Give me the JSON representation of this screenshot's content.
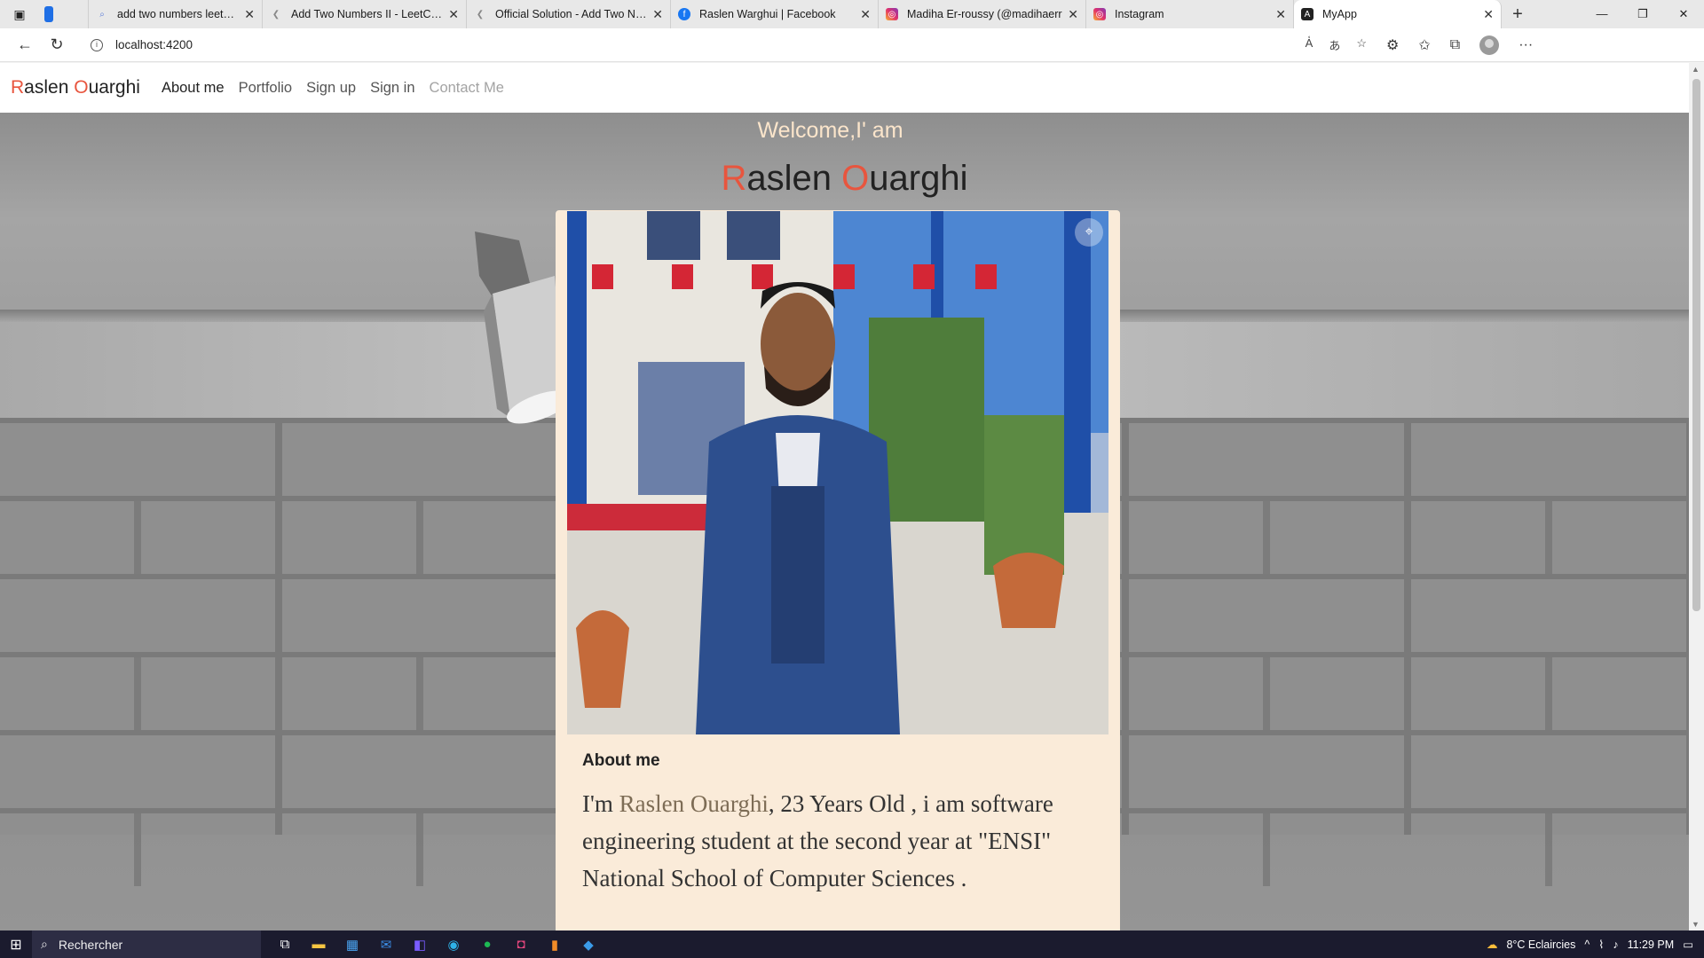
{
  "browser": {
    "tabs": [
      {
        "title": "add two numbers leetcode - Re",
        "icon": "search-icon",
        "active": false
      },
      {
        "title": "Add Two Numbers II - LeetCode",
        "icon": "leetcode-icon",
        "active": false
      },
      {
        "title": "Official Solution - Add Two Num",
        "icon": "leetcode-icon",
        "active": false
      },
      {
        "title": "Raslen Warghui | Facebook",
        "icon": "facebook-icon",
        "active": false
      },
      {
        "title": "Madiha Er-roussy (@madihaerr",
        "icon": "instagram-icon",
        "active": false
      },
      {
        "title": "Instagram",
        "icon": "instagram-icon",
        "active": false
      },
      {
        "title": "MyApp",
        "icon": "angular-icon",
        "active": true
      }
    ],
    "url": "localhost:4200"
  },
  "navbar": {
    "brand_r": "R",
    "brand_rest1": "aslen ",
    "brand_o": "O",
    "brand_rest2": "uarghi",
    "links": [
      "About me",
      "Portfolio",
      "Sign up",
      "Sign in",
      "Contact Me"
    ]
  },
  "hero": {
    "welcome": "Welcome,I' am",
    "name_r": "R",
    "name_rest1": "aslen ",
    "name_o": "O",
    "name_rest2": "uarghi"
  },
  "card": {
    "heading": "About me",
    "text_prefix": "I'm ",
    "text_name": "Raslen Ouarghi",
    "text_rest": ", 23 Years Old , i am software engineering student at the second year at \"ENSI\" National School of Computer Sciences ."
  },
  "taskbar": {
    "search_placeholder": "Rechercher",
    "weather": "8°C  Eclaircies",
    "time": "11:29 PM"
  },
  "colors": {
    "accent_red": "#e8553e",
    "card_bg": "#faebd9",
    "welcome": "#fbe5cb"
  }
}
